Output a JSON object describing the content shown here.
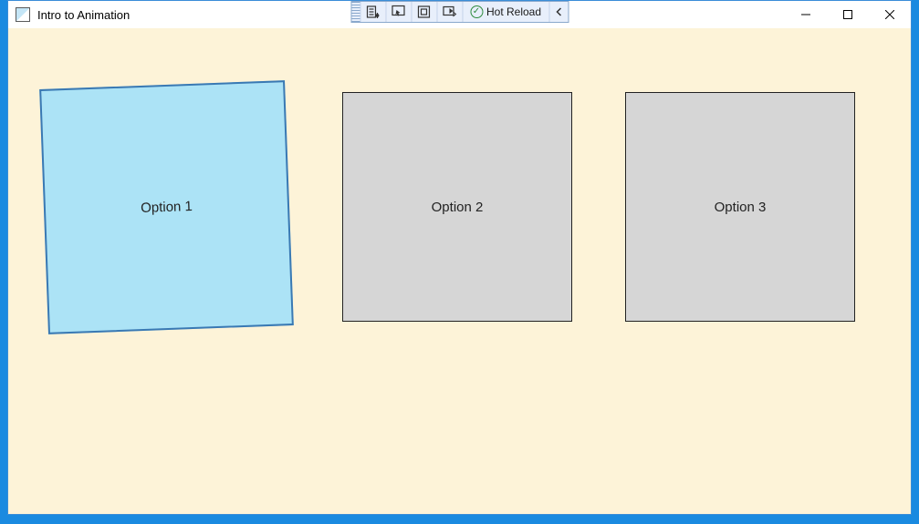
{
  "window": {
    "title": "Intro to Animation"
  },
  "debugToolbar": {
    "hotReloadLabel": "Hot Reload"
  },
  "cards": {
    "option1": "Option 1",
    "option2": "Option 2",
    "option3": "Option 3"
  }
}
